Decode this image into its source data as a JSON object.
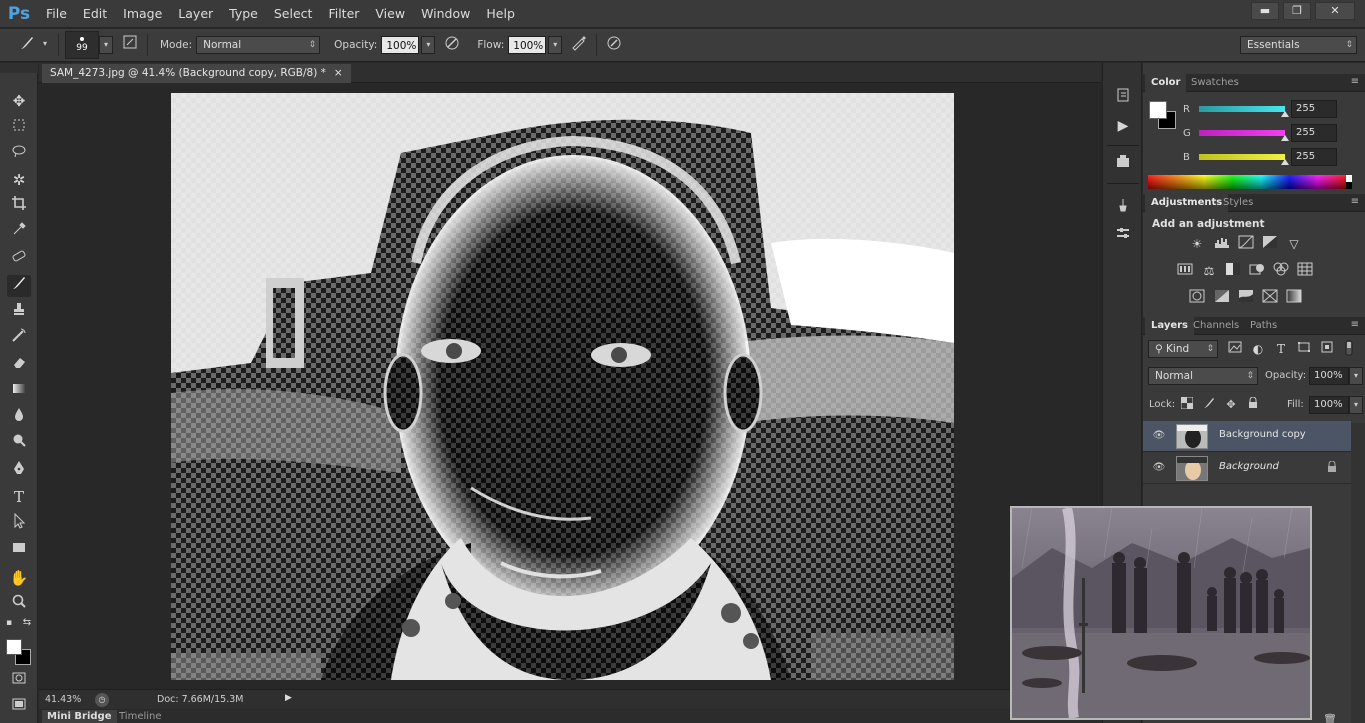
{
  "app": {
    "logo": "Ps"
  },
  "menu": [
    "File",
    "Edit",
    "Image",
    "Layer",
    "Type",
    "Select",
    "Filter",
    "View",
    "Window",
    "Help"
  ],
  "window_controls": {
    "minimize": "▬",
    "restore": "❐",
    "close": "✕"
  },
  "options_bar": {
    "brush_size": "99",
    "mode_label": "Mode:",
    "mode_value": "Normal",
    "opacity_label": "Opacity:",
    "opacity_value": "100%",
    "flow_label": "Flow:",
    "flow_value": "100%",
    "workspace": "Essentials"
  },
  "document": {
    "tab_title": "SAM_4273.jpg @ 41.4% (Background copy, RGB/8) *",
    "tab_close": "×"
  },
  "status": {
    "zoom": "41.43%",
    "doc_info": "Doc: 7.66M/15.3M"
  },
  "bottom_tabs": [
    "Mini Bridge",
    "Timeline"
  ],
  "color_panel": {
    "tabs": [
      "Color",
      "Swatches"
    ],
    "channels": [
      {
        "label": "R",
        "value": "255",
        "color": "#46e6f0"
      },
      {
        "label": "G",
        "value": "255",
        "color": "#f040f0"
      },
      {
        "label": "B",
        "value": "255",
        "color": "#f0f040"
      }
    ],
    "foreground": "#ffffff",
    "background": "#000000"
  },
  "adjustments_panel": {
    "tabs": [
      "Adjustments",
      "Styles"
    ],
    "title": "Add an adjustment"
  },
  "layers_panel": {
    "tabs": [
      "Layers",
      "Channels",
      "Paths"
    ],
    "filter_kind": "Kind",
    "blend_mode": "Normal",
    "opacity_label": "Opacity:",
    "opacity_value": "100%",
    "lock_label": "Lock:",
    "fill_label": "Fill:",
    "fill_value": "100%",
    "layers": [
      {
        "name": "Background copy",
        "selected": true,
        "locked": false
      },
      {
        "name": "Background",
        "selected": false,
        "locked": true
      }
    ],
    "selection_color": "#4b5565"
  },
  "accent_color": "#4fa3e0"
}
